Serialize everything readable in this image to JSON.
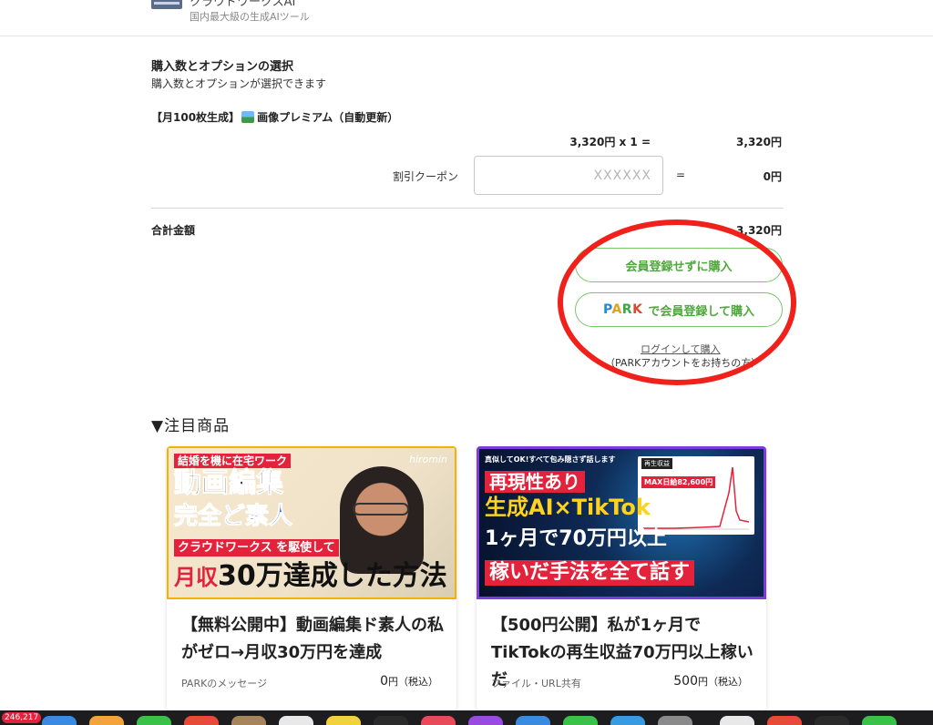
{
  "header": {
    "site_name": "クラウドワークスAI",
    "tagline": "国内最大級の生成AIツール"
  },
  "order": {
    "title": "購入数とオプションの選択",
    "subtitle": "購入数とオプションが選択できます",
    "product_prefix": "【月100枚生成】",
    "product_name": "画像プレミアム（自動更新）",
    "unit_calc": "3,320円 x 1 =",
    "line_total": "3,320円",
    "coupon_label": "割引クーポン",
    "coupon_placeholder": "XXXXXX",
    "coupon_equals": "=",
    "coupon_amount": "0円",
    "total_label": "合計金額",
    "total_value": "3,320円"
  },
  "buttons": {
    "guest": "会員登録せずに購入",
    "park_logo": [
      "P",
      "A",
      "R",
      "K"
    ],
    "park_label": "で会員登録して購入",
    "login_link": "ログインして購入",
    "login_note": "（PARKアカウントをお持ちの方）"
  },
  "featured": {
    "title": "▼注目商品",
    "cards": [
      {
        "thumb": {
          "line1": "結婚を機に在宅ワーク",
          "line2": "動画編集",
          "line3": "完全ど素人",
          "line4": "クラウドワークス を駆使して",
          "line5_prefix": "月収",
          "line5": "30万達成した方法",
          "watermark": "hiromin"
        },
        "title": "【無料公開中】動画編集ド素人の私がゼロ→月収30万円を達成",
        "meta": "PARKのメッセージ",
        "price": "0",
        "price_unit": "円（税込）"
      },
      {
        "thumb": {
          "line1": "真似してOK!すべて包み隠さず話します",
          "line2": "再現性あり",
          "line3": "生成AI×TikTok",
          "line4": "1ヶ月で70万円以上",
          "line5": "稼いだ手法を全て話す",
          "chart_title": "再生収益",
          "chart_badge": "MAX日給82,600円"
        },
        "title": "【500円公開】私が1ヶ月でTikTokの再生収益70万円以上稼いだ",
        "meta": "ファイル・URL共有",
        "price": "500",
        "price_unit": "円（税込）"
      }
    ]
  },
  "dock": {
    "badge": "246,217"
  },
  "colors": {
    "accent_green": "#4fa83c",
    "annotation_red": "#f0201a",
    "badge_red": "#e2233b"
  }
}
